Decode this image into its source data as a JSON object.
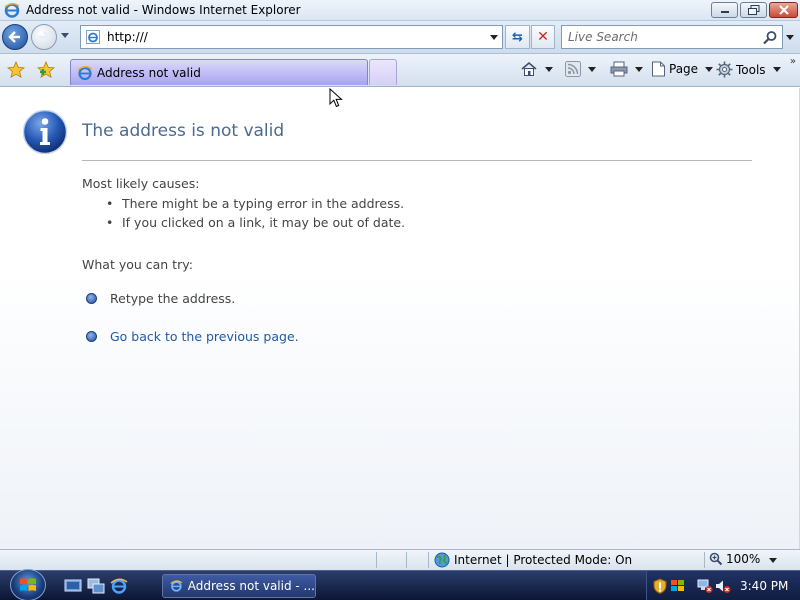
{
  "window": {
    "title": "Address not valid - Windows Internet Explorer"
  },
  "address_bar": {
    "url": "http:///",
    "search_placeholder": "Live Search"
  },
  "tabs": [
    {
      "label": "Address not valid"
    }
  ],
  "command_bar": {
    "page_label": "Page",
    "tools_label": "Tools"
  },
  "content": {
    "heading": "The address is not valid",
    "causes_label": "Most likely causes:",
    "causes": [
      "There might be a typing error in the address.",
      "If you clicked on a link, it may be out of date."
    ],
    "try_label": "What you can try:",
    "try_items": [
      {
        "text": "Retype the address."
      },
      {
        "text": "Go back to the previous page."
      }
    ]
  },
  "status_bar": {
    "zone": "Internet | Protected Mode: On",
    "zoom": "100%"
  },
  "taskbar": {
    "task_label": "Address not valid - ...",
    "clock": "3:40 PM"
  },
  "colors": {
    "heading": "#4a6a8f",
    "link": "#1e5aa6",
    "tab_active": "#a7a3ef"
  }
}
